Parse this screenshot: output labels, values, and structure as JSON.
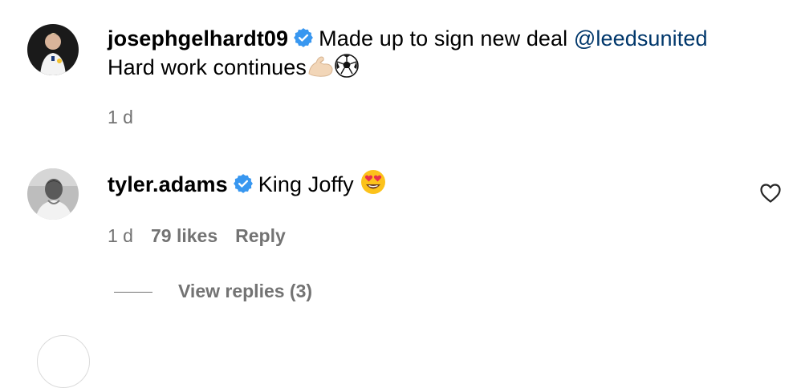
{
  "comments": [
    {
      "username": "josephgelhardt09",
      "text": "Made up to sign new deal",
      "mention": "@leedsunited",
      "line2": "Hard work continues",
      "emoji": [
        "flexed-biceps",
        "soccer-ball"
      ],
      "time": "1 d"
    },
    {
      "username": "tyler.adams",
      "text": "King Joffy",
      "emoji": [
        "heart-eyes"
      ],
      "time": "1 d",
      "likes": "79 likes",
      "reply_label": "Reply",
      "view_replies": "View replies (3)"
    }
  ],
  "colors": {
    "verified": "#3897f0",
    "mention": "#00376b",
    "meta": "#737373"
  }
}
